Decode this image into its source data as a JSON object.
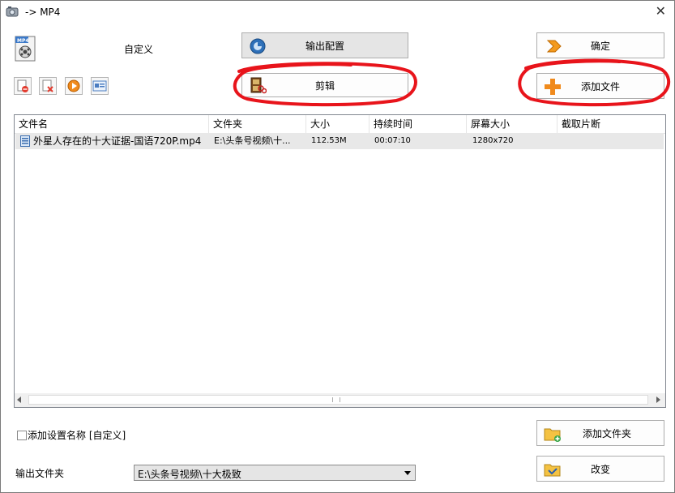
{
  "window": {
    "title": "-> MP4",
    "close_glyph": "✕"
  },
  "preset": {
    "label": "自定义",
    "icon": "mp4-file-icon"
  },
  "buttons": {
    "output_config": "输出配置",
    "confirm": "确定",
    "edit": "剪辑",
    "add_file": "添加文件",
    "add_folder": "添加文件夹",
    "change": "改变"
  },
  "toolbar": [
    "remove-item-icon",
    "clear-list-icon",
    "play-icon",
    "media-info-icon"
  ],
  "table": {
    "columns": [
      "文件名",
      "文件夹",
      "大小",
      "持续时间",
      "屏幕大小",
      "截取片断"
    ],
    "rows": [
      {
        "name": "外星人存在的十大证据-国语720P.mp4",
        "folder": "E:\\头条号视频\\十...",
        "size": "112.53M",
        "duration": "00:07:10",
        "screen": "1280x720",
        "clip": ""
      }
    ]
  },
  "options": {
    "add_preset_name": "添加设置名称 [自定义]",
    "output_folder_label": "输出文件夹",
    "output_folder_value": "E:\\头条号视频\\十大极致"
  },
  "colors": {
    "annotation": "#e8141b",
    "button_face": "#e5e5e5",
    "row_highlight": "#e8e8e8"
  }
}
